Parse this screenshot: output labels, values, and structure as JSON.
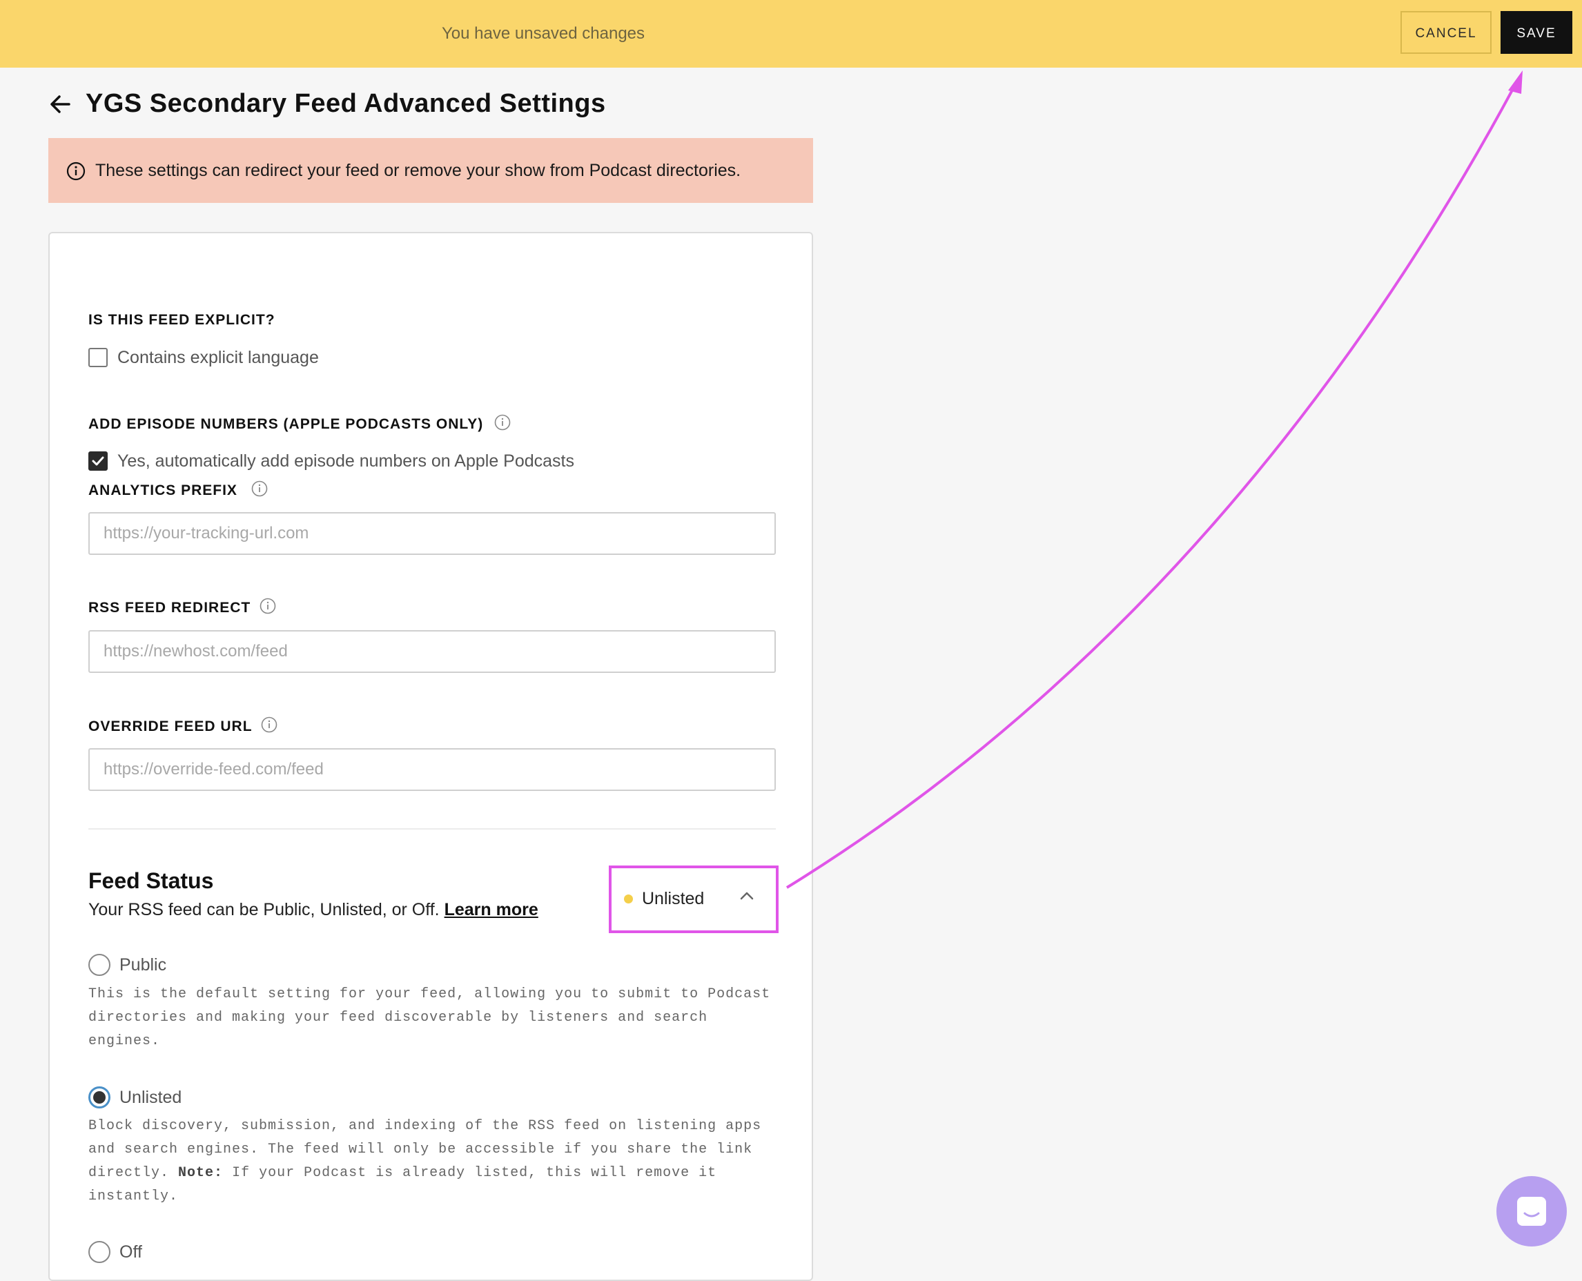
{
  "topbar": {
    "message": "You have unsaved changes",
    "cancel_label": "CANCEL",
    "save_label": "SAVE"
  },
  "header": {
    "back_icon": "arrow-left-icon",
    "title": "YGS Secondary Feed Advanced Settings"
  },
  "warning": {
    "icon": "info-icon",
    "text": "These settings can redirect your feed or remove your show from Podcast directories.",
    "background": "#f6c8b8"
  },
  "explicit": {
    "label": "IS THIS FEED EXPLICIT?",
    "checkbox_label": "Contains explicit language",
    "checked": false
  },
  "episode_numbers": {
    "label": "ADD EPISODE NUMBERS (APPLE PODCASTS ONLY)",
    "checkbox_label": "Yes, automatically add episode numbers on Apple Podcasts",
    "checked": true
  },
  "analytics_prefix": {
    "label": "ANALYTICS PREFIX",
    "placeholder": "https://your-tracking-url.com",
    "value": ""
  },
  "rss_redirect": {
    "label": "RSS FEED REDIRECT",
    "placeholder": "https://newhost.com/feed",
    "value": ""
  },
  "override_url": {
    "label": "OVERRIDE FEED URL",
    "placeholder": "https://override-feed.com/feed",
    "value": ""
  },
  "feed_status": {
    "title": "Feed Status",
    "description": "Your RSS feed can be Public, Unlisted, or Off.",
    "learn_more": "Learn more",
    "current": "Unlisted",
    "status_color": "#f4cf4a",
    "options": [
      {
        "label": "Public",
        "description": "This is the default setting for your feed, allowing you to submit to Podcast directories and making your feed discoverable by listeners and search engines.",
        "selected": false
      },
      {
        "label": "Unlisted",
        "description_before": "Block discovery, submission, and indexing of the RSS feed on listening apps and search engines. The feed will only be accessible if you share the link directly.",
        "note_label": "Note:",
        "description_after": "If your Podcast is already listed, this will remove it instantly.",
        "selected": true
      },
      {
        "label": "Off",
        "selected": false
      }
    ]
  },
  "colors": {
    "topbar": "#fad66b",
    "annotation": "#e055e8",
    "chat_button": "#b79ff0"
  },
  "chat": {
    "icon": "chat-icon"
  }
}
